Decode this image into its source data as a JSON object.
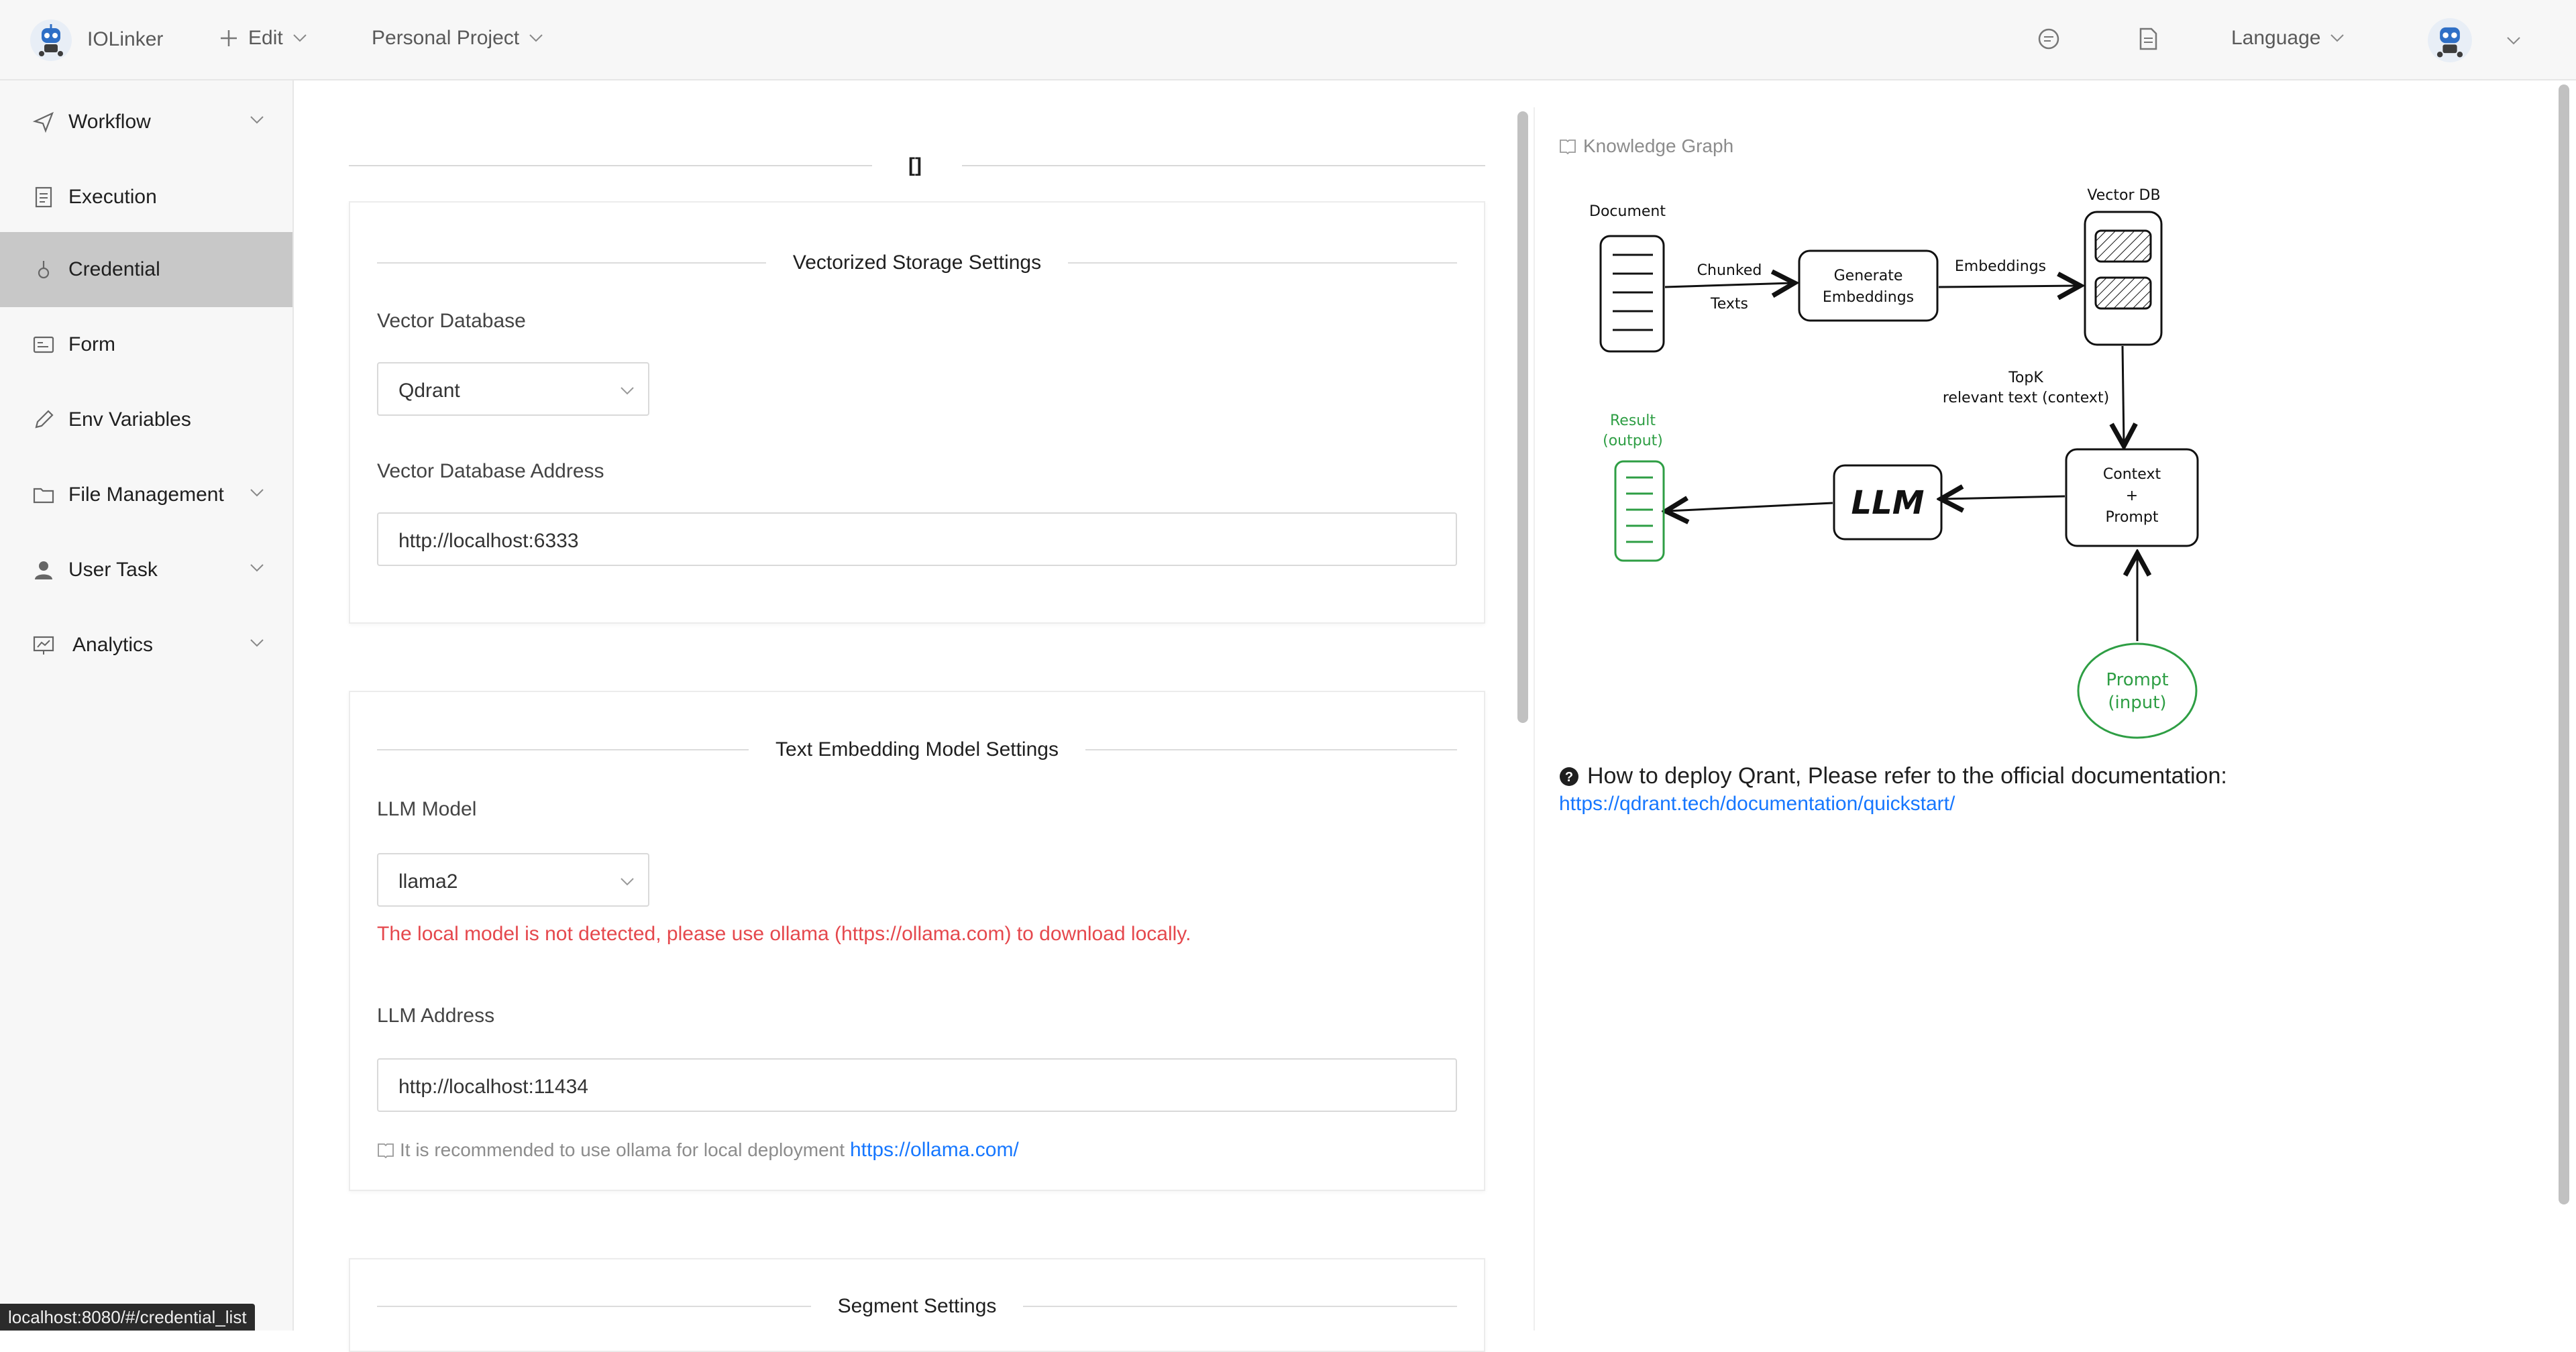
{
  "header": {
    "brand": "IOLinker",
    "edit_label": "Edit",
    "project_label": "Personal Project",
    "language_label": "Language"
  },
  "sidebar": {
    "items": [
      {
        "label": "Workflow",
        "icon": "send-icon",
        "expandable": true
      },
      {
        "label": "Execution",
        "icon": "document-icon",
        "expandable": false
      },
      {
        "label": "Credential",
        "icon": "key-icon",
        "expandable": false,
        "active": true
      },
      {
        "label": "Form",
        "icon": "form-icon",
        "expandable": false
      },
      {
        "label": "Env Variables",
        "icon": "pen-icon",
        "expandable": false
      },
      {
        "label": "File Management",
        "icon": "folder-icon",
        "expandable": true
      },
      {
        "label": "User Task",
        "icon": "user-icon",
        "expandable": true
      },
      {
        "label": "Analytics",
        "icon": "chart-icon",
        "expandable": true
      }
    ]
  },
  "main": {
    "bracket": "[]",
    "vector_card": {
      "title": "Vectorized Storage Settings",
      "db_label": "Vector Database",
      "db_value": "Qdrant",
      "address_label": "Vector Database Address",
      "address_value": "http://localhost:6333"
    },
    "embedding_card": {
      "title": "Text Embedding Model Settings",
      "model_label": "LLM Model",
      "model_value": "llama2",
      "error": "The local model is not detected, please use ollama (https://ollama.com) to download locally.",
      "address_label": "LLM Address",
      "address_value": "http://localhost:11434",
      "hint": "It is recommended to use ollama for local deployment",
      "hint_link": "https://ollama.com/"
    },
    "segment_card": {
      "title": "Segment Settings"
    }
  },
  "right": {
    "kg_title": "Knowledge Graph",
    "diagram": {
      "document": "Document",
      "chunked": "Chunked",
      "texts": "Texts",
      "generate": "Generate",
      "embeddings_box": "Embeddings",
      "embeddings_arrow": "Embeddings",
      "vector_db": "Vector DB",
      "topk": "TopK",
      "relevant": "relevant text (context)",
      "context": "Context",
      "plus": "+",
      "prompt": "Prompt",
      "llm": "LLM",
      "result": "Result",
      "output": "(output)",
      "prompt_in": "Prompt",
      "input": "(input)"
    },
    "deploy_text": "How to deploy Qrant, Please refer to the official documentation:",
    "deploy_link": "https://qdrant.tech/documentation/quickstart/"
  },
  "status_bar": "localhost:8080/#/credential_list",
  "colors": {
    "accent": "#1677ff",
    "error": "#e5484d",
    "active_nav": "#c8c8c8",
    "green": "#2e9e44"
  }
}
